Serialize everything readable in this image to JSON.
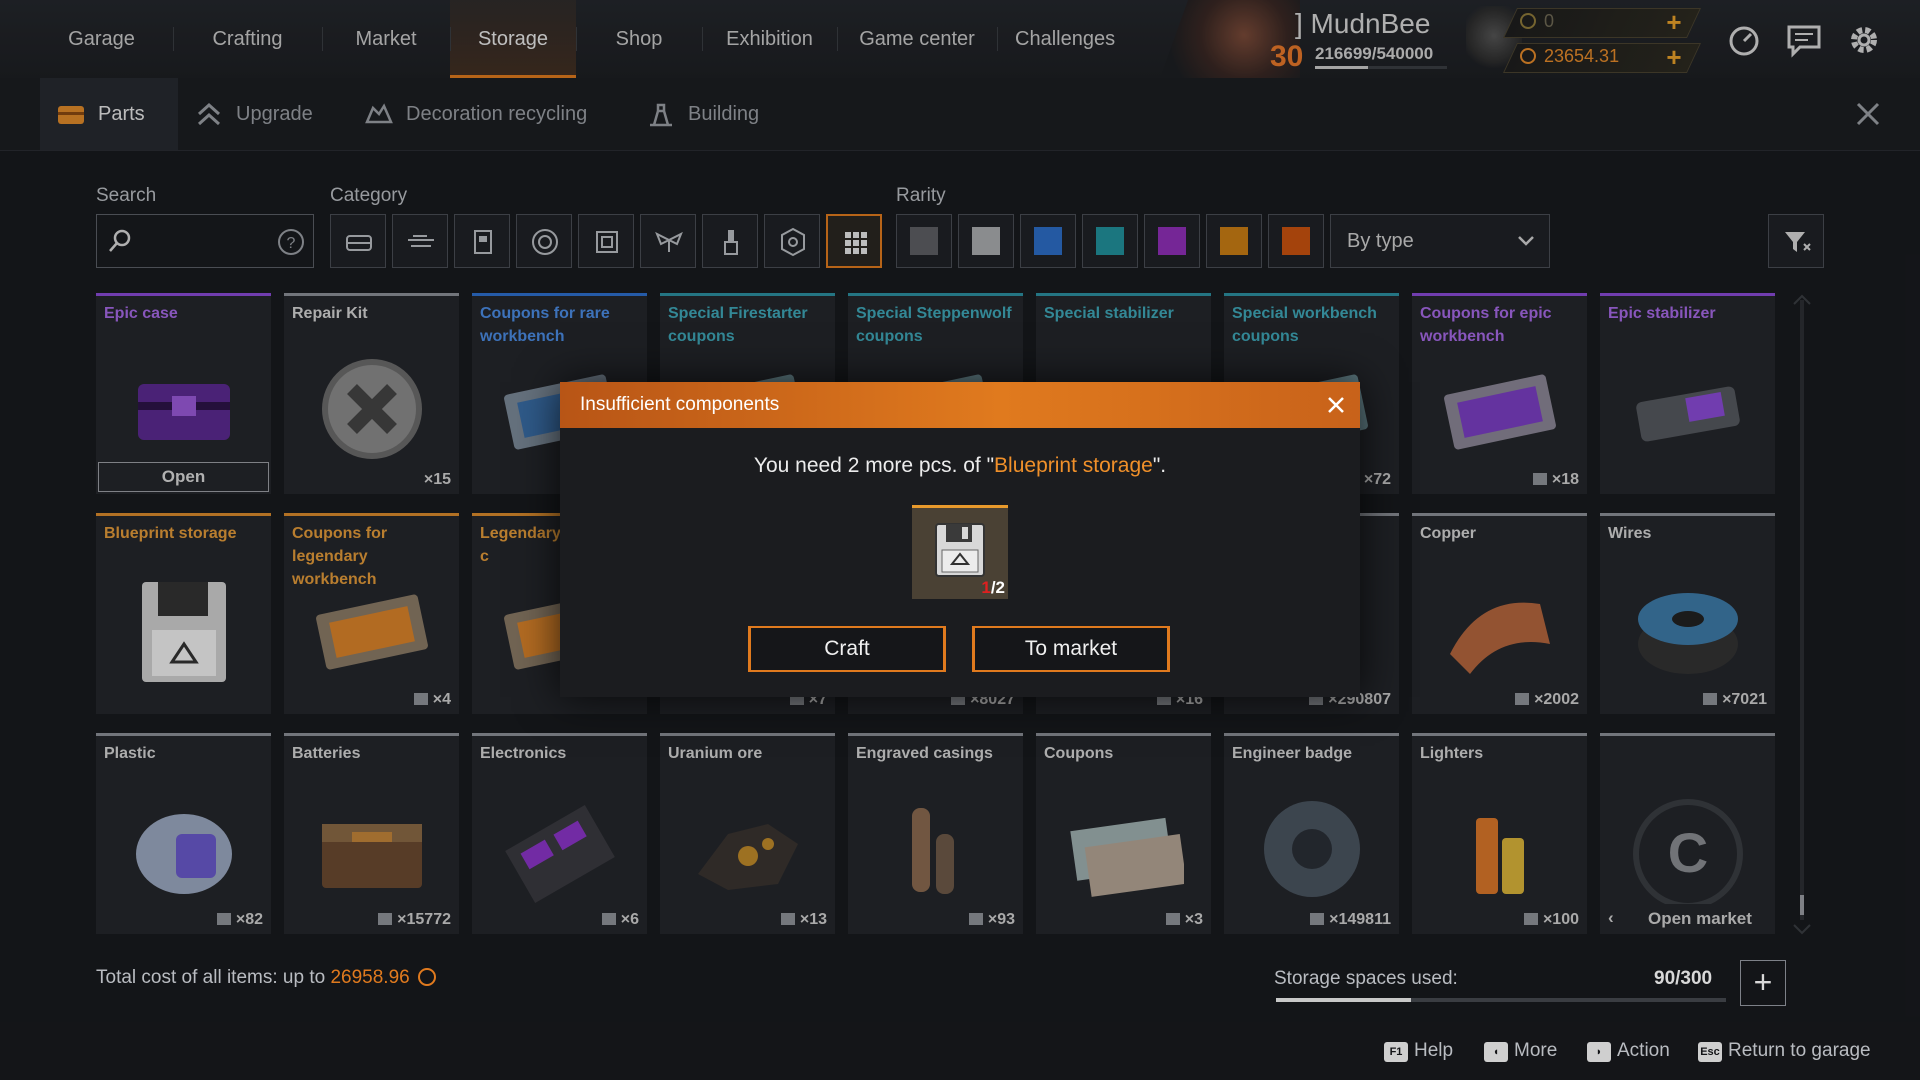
{
  "nav": {
    "items": [
      "Garage",
      "Crafting",
      "Market",
      "Storage",
      "Shop",
      "Exhibition",
      "Game center",
      "Challenges"
    ],
    "active": "Storage"
  },
  "player": {
    "name": "] MudnBee",
    "level": "30",
    "xp": "216699/540000",
    "xp_progress": 0.401,
    "currency_1": "0",
    "currency_2": "23654.31"
  },
  "subtabs": [
    "Parts",
    "Upgrade",
    "Decoration recycling",
    "Building"
  ],
  "filters": {
    "search_label": "Search",
    "category_label": "Category",
    "rarity_label": "Rarity",
    "sort_value": "By type",
    "rarity_colors": [
      "#5d5f63",
      "#a9abae",
      "#2d6dc6",
      "#21919c",
      "#8f2fb8",
      "#c97d14",
      "#c9520f"
    ]
  },
  "items": [
    {
      "title": "Epic case",
      "count": "",
      "action": "Open",
      "rarity": "epic"
    },
    {
      "title": "Repair Kit",
      "count": "×15",
      "rarity": "common"
    },
    {
      "title": "Coupons for rare workbench",
      "count": "",
      "rarity": "rare"
    },
    {
      "title": "Special Firestarter coupons",
      "count": "",
      "rarity": "special"
    },
    {
      "title": "Special Steppenwolf coupons",
      "count": "",
      "rarity": "special"
    },
    {
      "title": "Special stabilizer",
      "count": "",
      "rarity": "special"
    },
    {
      "title": "Special workbench coupons",
      "count": "×72",
      "rarity": "special"
    },
    {
      "title": "Coupons for epic workbench",
      "count": "×18",
      "rarity": "epic"
    },
    {
      "title": "Epic stabilizer",
      "count": "",
      "rarity": "epic"
    },
    {
      "title": "Blueprint storage",
      "count": "",
      "rarity": "legendary"
    },
    {
      "title": "Coupons for legendary workbench",
      "count": "×4",
      "rarity": "legendary"
    },
    {
      "title": "Legendary children c",
      "count": "",
      "rarity": "legendary"
    },
    {
      "title": "",
      "count": "×7",
      "rarity": "common"
    },
    {
      "title": "",
      "count": "×8027",
      "rarity": "common"
    },
    {
      "title": "",
      "count": "×16",
      "rarity": "common"
    },
    {
      "title": "",
      "count": "×290807",
      "rarity": "common"
    },
    {
      "title": "Copper",
      "count": "×2002",
      "rarity": "common"
    },
    {
      "title": "Wires",
      "count": "×7021",
      "rarity": "common"
    },
    {
      "title": "Plastic",
      "count": "×82",
      "rarity": "common"
    },
    {
      "title": "Batteries",
      "count": "×15772",
      "rarity": "common"
    },
    {
      "title": "Electronics",
      "count": "×6",
      "rarity": "common"
    },
    {
      "title": "Uranium ore",
      "count": "×13",
      "rarity": "common"
    },
    {
      "title": "Engraved casings",
      "count": "×93",
      "rarity": "common"
    },
    {
      "title": "Coupons",
      "count": "×3",
      "rarity": "common"
    },
    {
      "title": "Engineer badge",
      "count": "×149811",
      "rarity": "common"
    },
    {
      "title": "Lighters",
      "count": "×100",
      "rarity": "common"
    },
    {
      "title": "",
      "count": "",
      "action": "Open market",
      "rarity": "common"
    }
  ],
  "dialog": {
    "title": "Insufficient components",
    "message_prefix": "You need 2 more pcs. of \"",
    "message_item": "Blueprint storage",
    "message_suffix": "\".",
    "have": "1",
    "need": "/2",
    "craft": "Craft",
    "market": "To market"
  },
  "footer": {
    "total_prefix": "Total cost of all items: up to ",
    "total_value": "26958.96",
    "storage_label": "Storage spaces used:",
    "storage_value": "90/300",
    "storage_fraction": 0.3
  },
  "hints": [
    {
      "key": "F1",
      "label": "Help"
    },
    {
      "key": "◖",
      "label": "More"
    },
    {
      "key": "◗",
      "label": "Action"
    },
    {
      "key": "Esc",
      "label": "Return to garage"
    }
  ]
}
